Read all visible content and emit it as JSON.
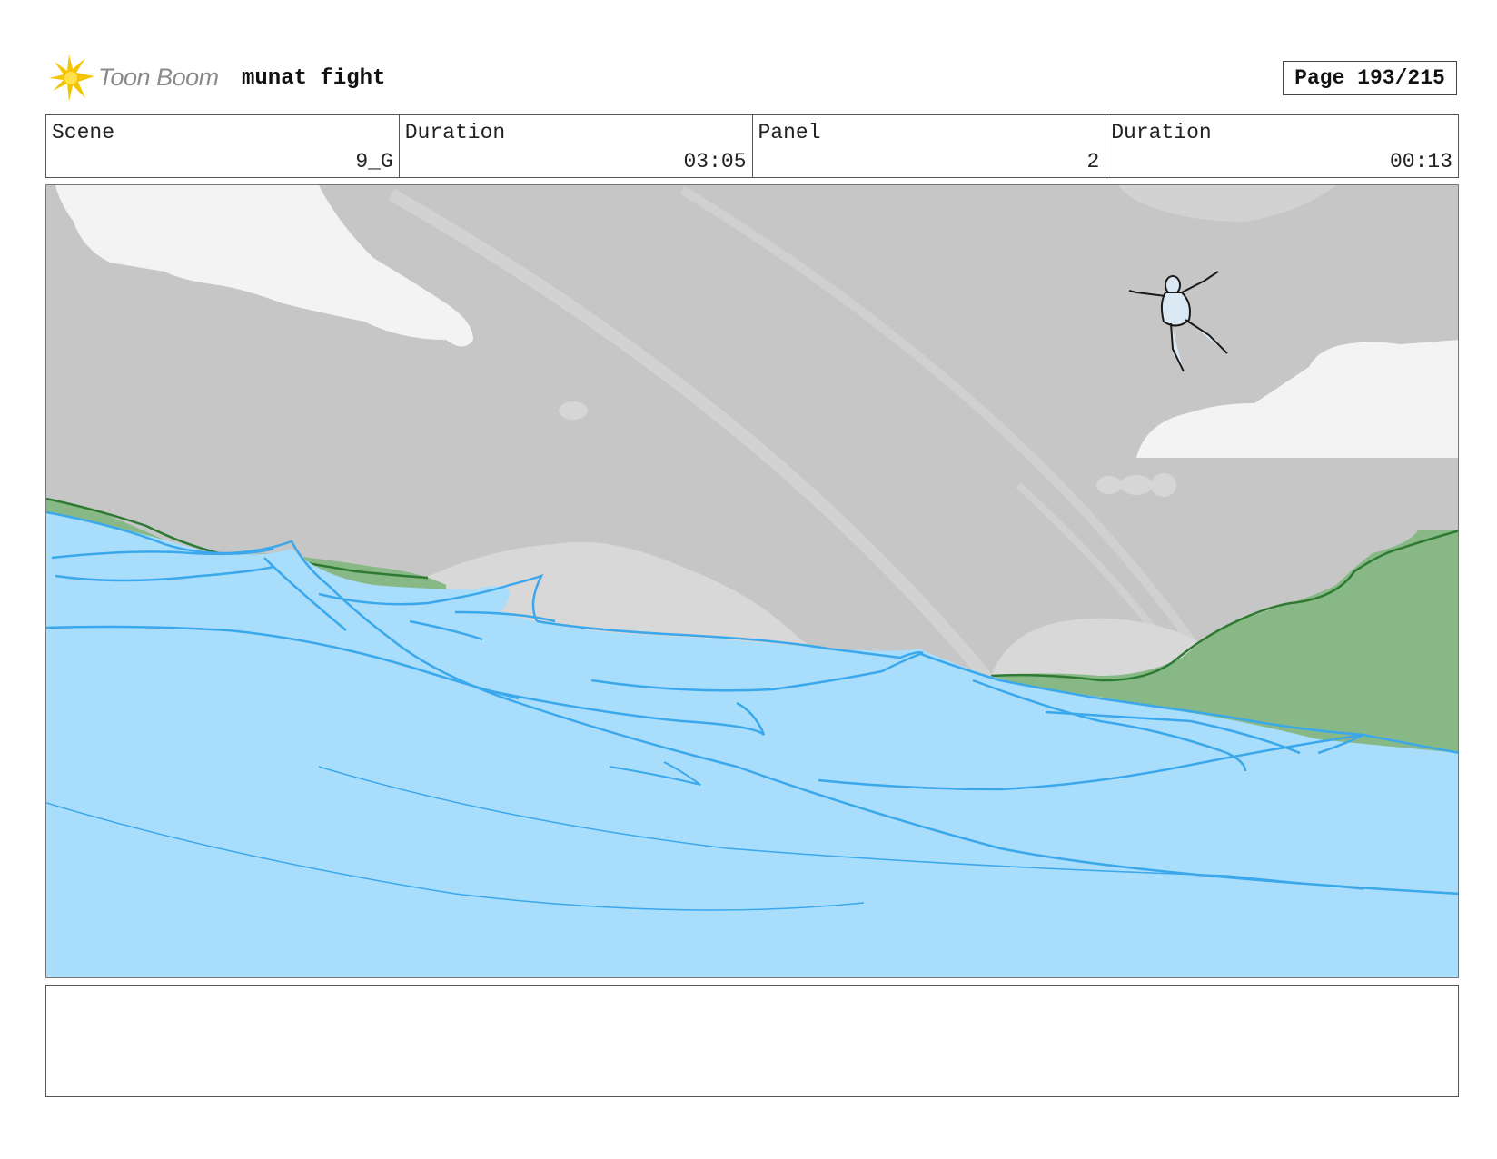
{
  "header": {
    "logo_text": "Toon Boom",
    "project_title": "munat fight",
    "page_label": "Page 193/215"
  },
  "info": {
    "scene_label": "Scene",
    "scene_value": "9_G",
    "scene_duration_label": "Duration",
    "scene_duration_value": "03:05",
    "panel_label": "Panel",
    "panel_value": "2",
    "panel_duration_label": "Duration",
    "panel_duration_value": "00:13"
  },
  "colors": {
    "sky": "#c6c6c6",
    "cloud": "#f3f3f3",
    "water": "#a8ddfc",
    "water_line": "#3aa8ea",
    "land": "#88b886",
    "land_line": "#2e7a32"
  },
  "notes": ""
}
